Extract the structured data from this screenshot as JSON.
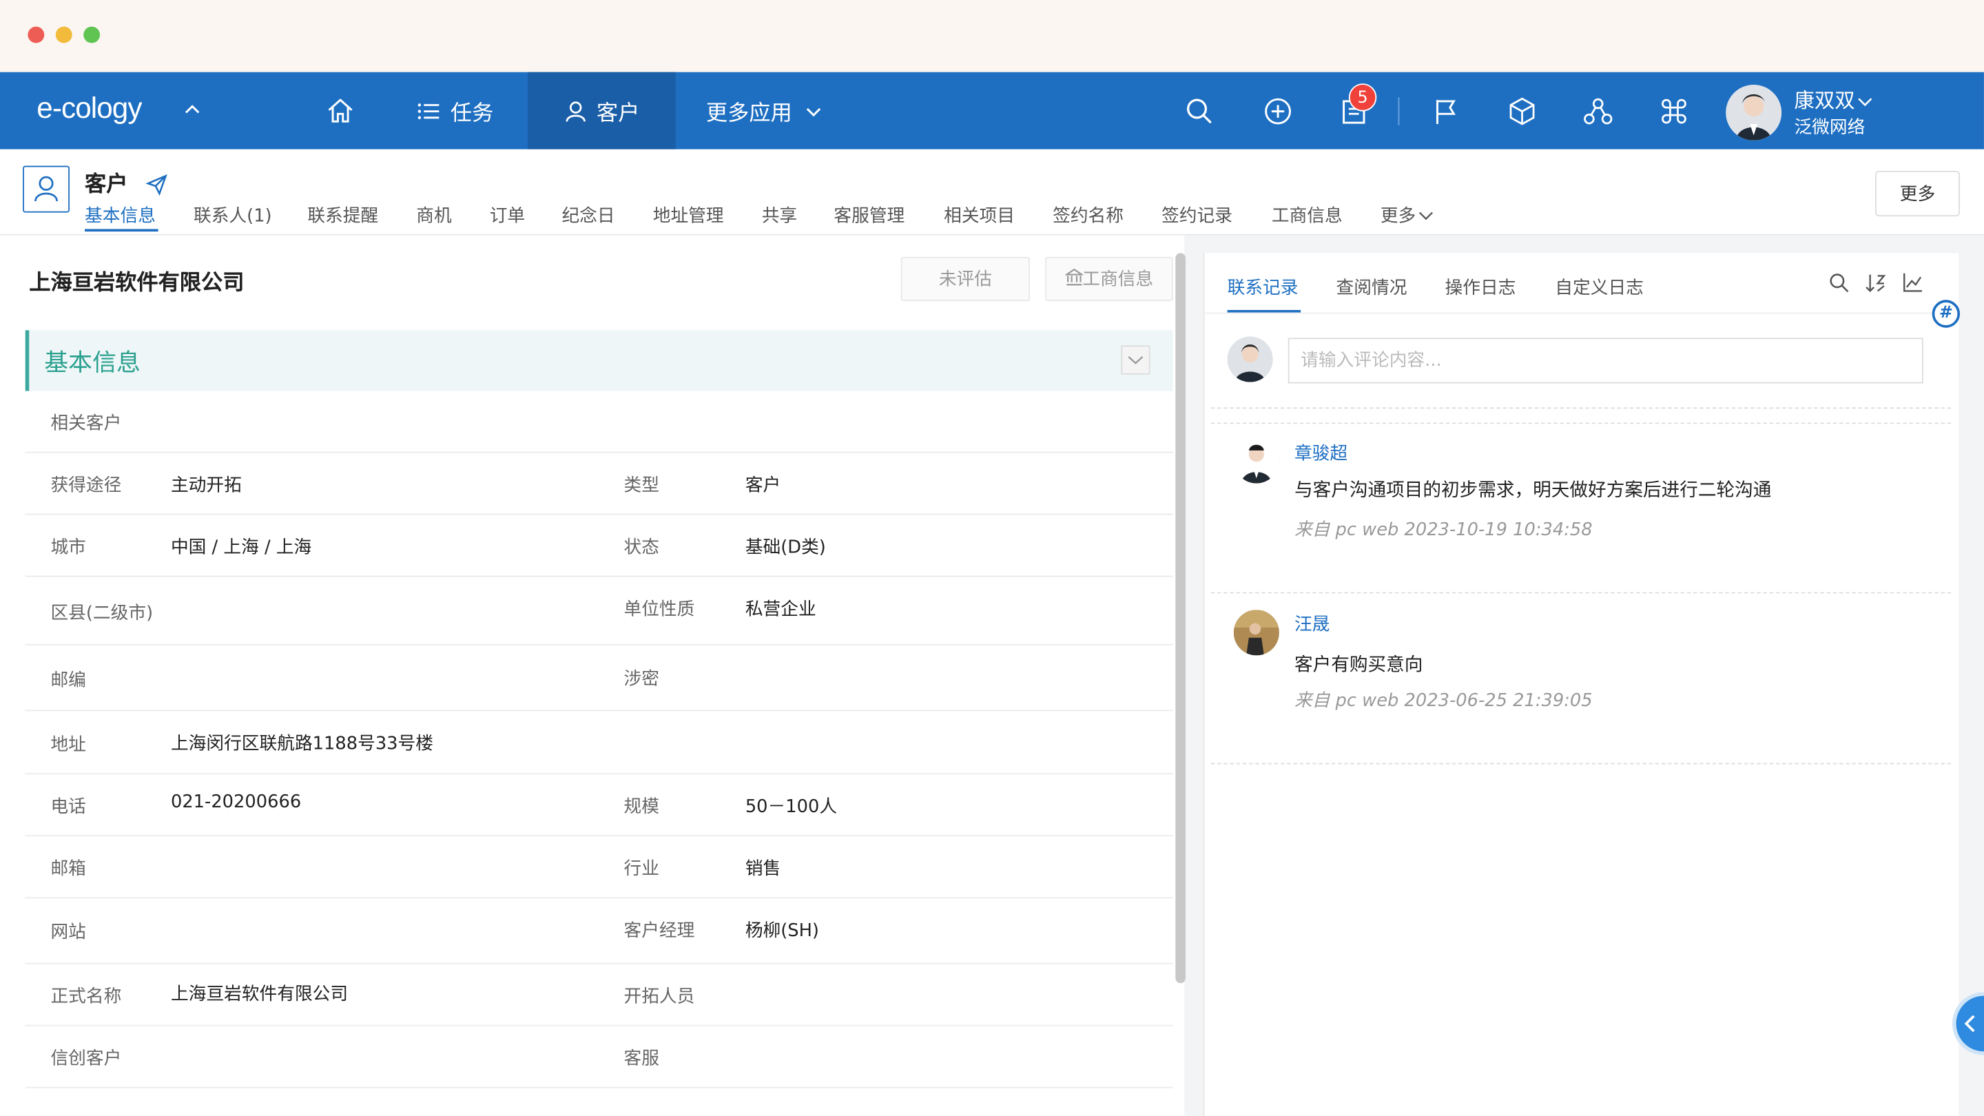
{
  "window": {
    "traffic_lights": [
      "#ee5d55",
      "#f2bb3b",
      "#5fc451"
    ]
  },
  "colors": {
    "brand": "#1e6fc2",
    "section_accent": "#2aa08f",
    "badge": "#f0413a"
  },
  "topnav": {
    "logo": "e-cology",
    "items": [
      {
        "label": "",
        "icon": "home-icon"
      },
      {
        "label": "任务",
        "icon": "list-icon"
      },
      {
        "label": "客户",
        "icon": "user-icon",
        "active": true
      },
      {
        "label": "更多应用",
        "icon": "chevron-down-icon"
      }
    ],
    "tools": [
      "search-icon",
      "plus-circle-icon",
      "document-icon",
      "flag-icon",
      "cube-icon",
      "org-icon",
      "command-icon"
    ],
    "badge_count": "5",
    "user": {
      "name": "康双双",
      "org": "泛微网络"
    }
  },
  "subheader": {
    "title": "客户",
    "tabs": [
      "基本信息",
      "联系人(1)",
      "联系提醒",
      "商机",
      "订单",
      "纪念日",
      "地址管理",
      "共享",
      "客服管理",
      "相关项目",
      "签约名称",
      "签约记录",
      "工商信息",
      "更多"
    ],
    "active_tab": "基本信息",
    "more_button": "更多"
  },
  "company": {
    "name": "上海亘岩软件有限公司",
    "eval_button": "未评估",
    "biz_button": "工商信息"
  },
  "section": {
    "title": "基本信息"
  },
  "fields": {
    "related_customer": {
      "label": "相关客户",
      "value": ""
    },
    "source": {
      "label": "获得途径",
      "value": "主动开拓"
    },
    "type": {
      "label": "类型",
      "value": "客户"
    },
    "city": {
      "label": "城市",
      "value": "中国 / 上海 / 上海"
    },
    "status": {
      "label": "状态",
      "value": "基础(D类)"
    },
    "district": {
      "label": "区县(二级市)",
      "value": ""
    },
    "nature": {
      "label": "单位性质",
      "value": "私营企业"
    },
    "postcode": {
      "label": "邮编",
      "value": ""
    },
    "secret": {
      "label": "涉密",
      "value": ""
    },
    "address": {
      "label": "地址",
      "value": "上海闵行区联航路1188号33号楼"
    },
    "phone": {
      "label": "电话",
      "value": "021-20200666"
    },
    "scale": {
      "label": "规模",
      "value": "50－100人"
    },
    "email": {
      "label": "邮箱",
      "value": ""
    },
    "industry": {
      "label": "行业",
      "value": "销售"
    },
    "website": {
      "label": "网站",
      "value": ""
    },
    "manager": {
      "label": "客户经理",
      "value": "杨柳(SH)"
    },
    "formal_name": {
      "label": "正式名称",
      "value": "上海亘岩软件有限公司"
    },
    "developer": {
      "label": "开拓人员",
      "value": ""
    },
    "xinchuang": {
      "label": "信创客户",
      "value": ""
    },
    "service": {
      "label": "客服",
      "value": ""
    }
  },
  "right": {
    "tabs": [
      "联系记录",
      "查阅情况",
      "操作日志",
      "自定义日志"
    ],
    "active_tab": "联系记录",
    "tools": [
      "search-icon",
      "sort-icon",
      "chart-icon"
    ],
    "comment_placeholder": "请输入评论内容...",
    "records": [
      {
        "name": "章骏超",
        "text": "与客户沟通项目的初步需求，明天做好方案后进行二轮沟通",
        "meta": "来自 pc web 2023-10-19 10:34:58"
      },
      {
        "name": "汪晟",
        "text": "客户有购买意向",
        "meta": "来自 pc web 2023-06-25 21:39:05"
      }
    ],
    "side_tag": "#"
  }
}
